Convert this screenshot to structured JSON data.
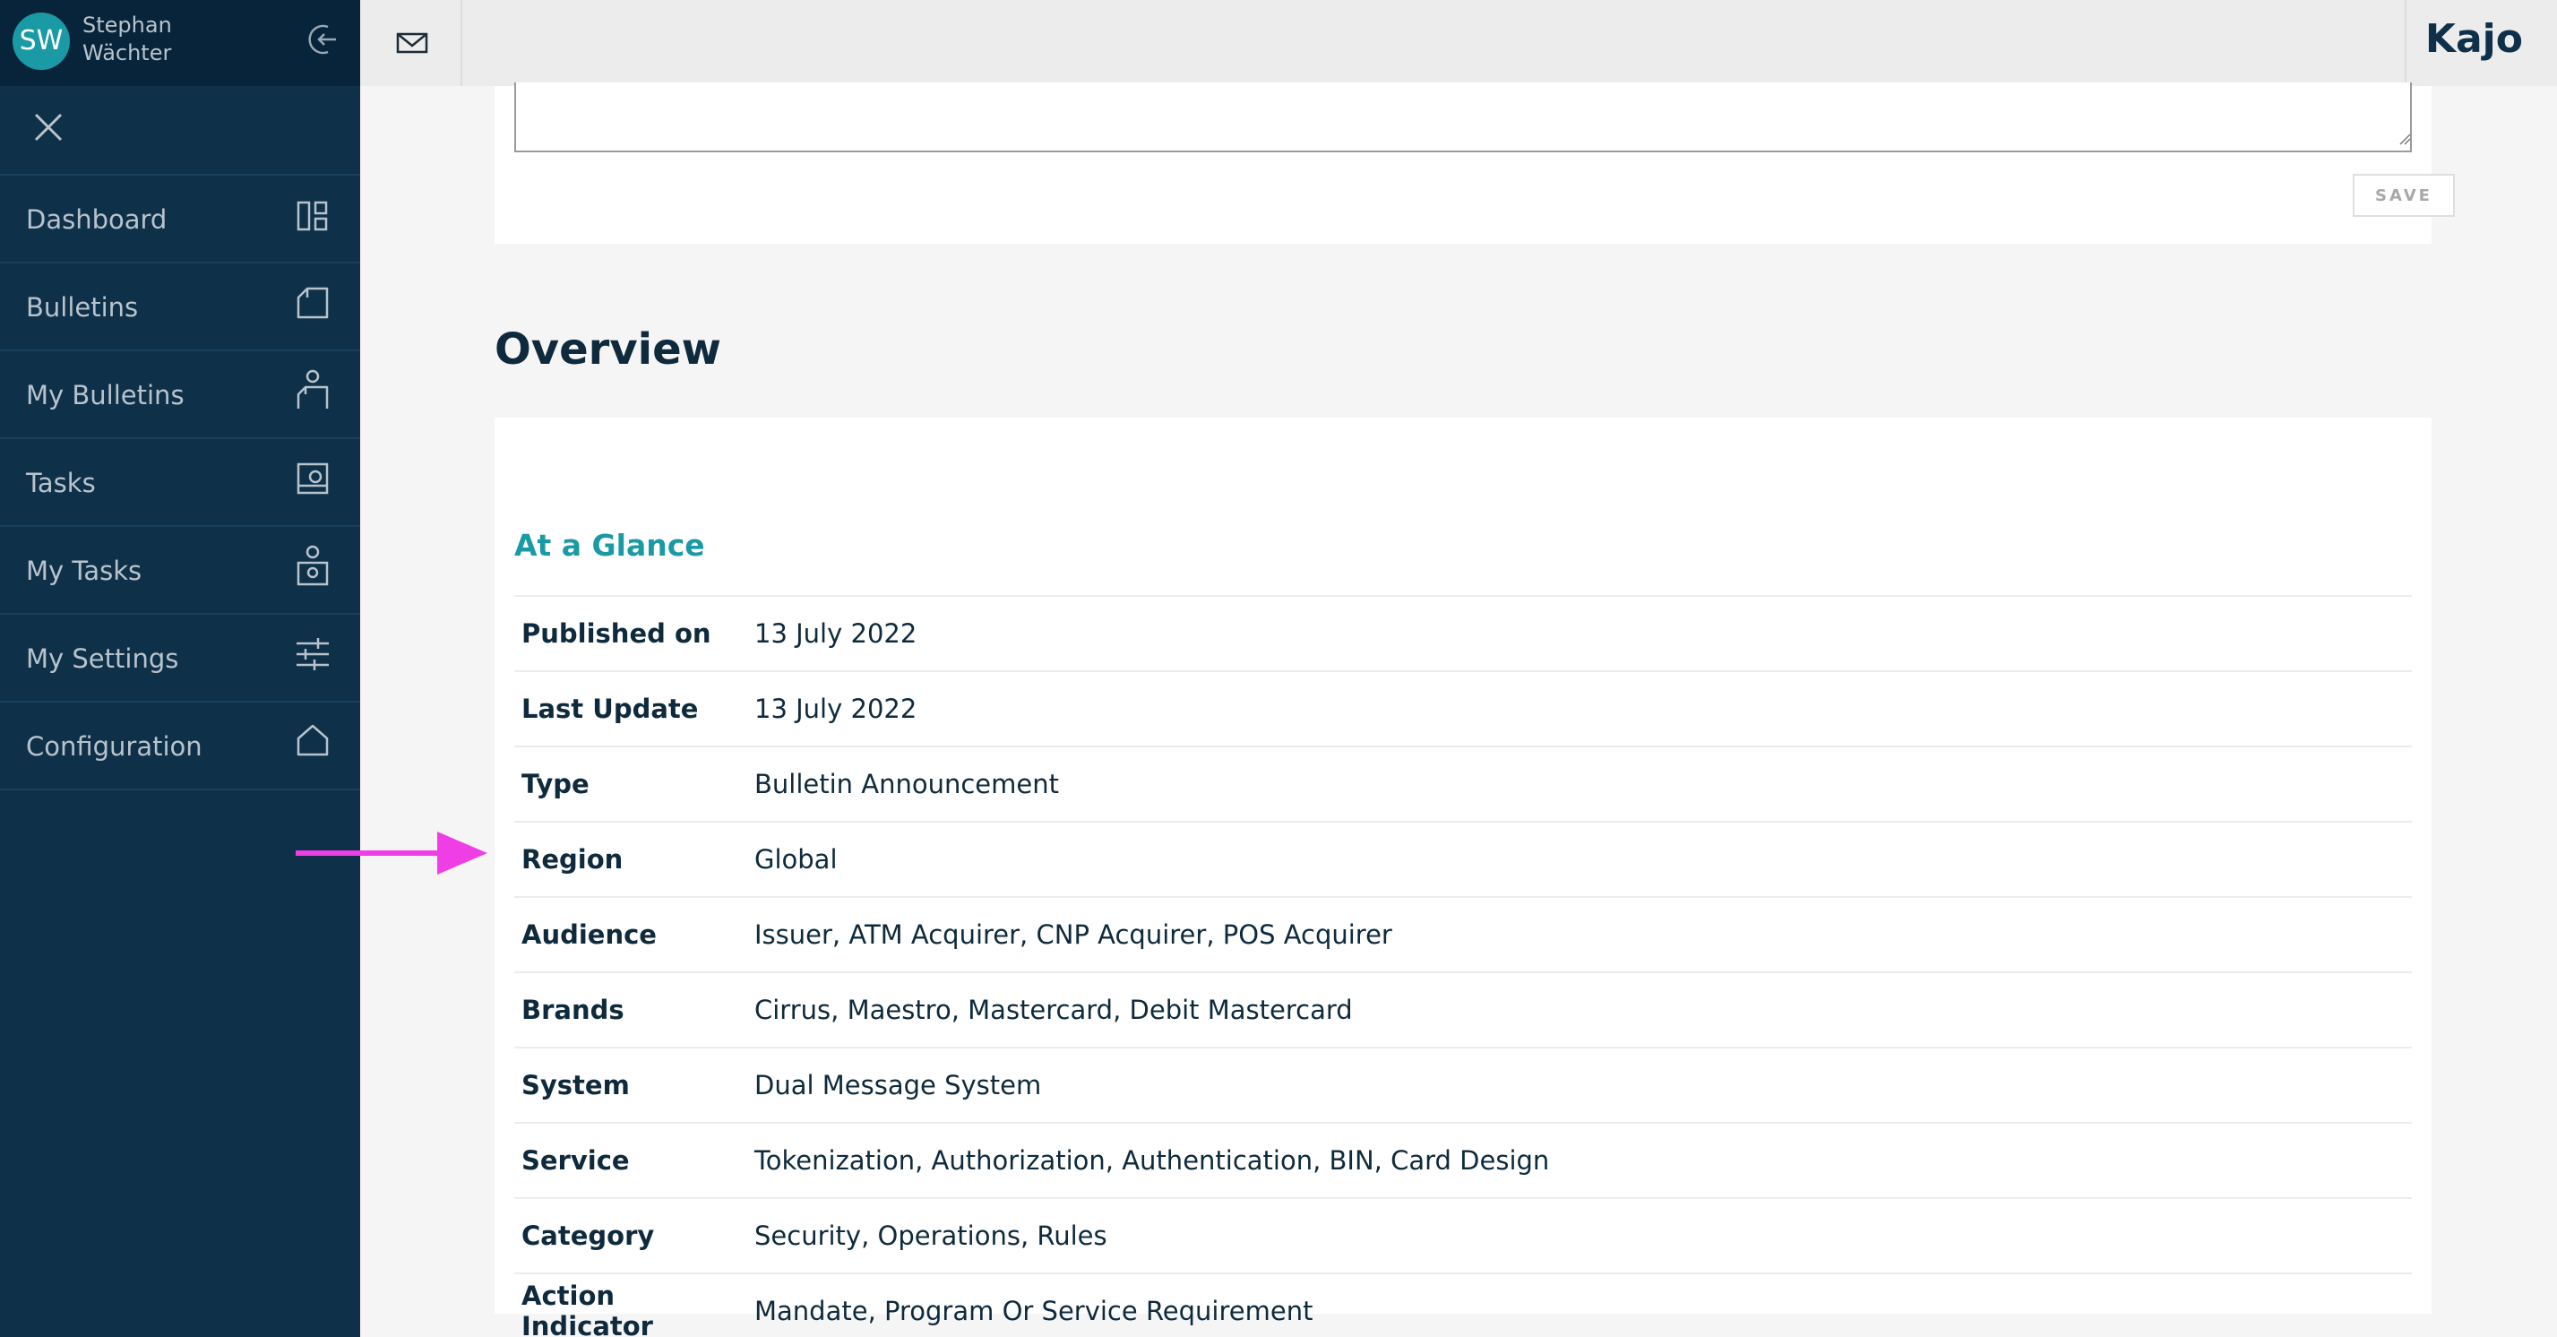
{
  "user": {
    "initials": "SW",
    "name": "Stephan Wächter"
  },
  "sidebar": {
    "items": [
      {
        "label": "Dashboard",
        "icon": "dashboard-icon"
      },
      {
        "label": "Bulletins",
        "icon": "bulletin-icon"
      },
      {
        "label": "My Bulletins",
        "icon": "person-bulletin-icon"
      },
      {
        "label": "Tasks",
        "icon": "task-icon"
      },
      {
        "label": "My Tasks",
        "icon": "person-task-icon"
      },
      {
        "label": "My Settings",
        "icon": "sliders-icon"
      },
      {
        "label": "Configuration",
        "icon": "home-icon"
      }
    ]
  },
  "header": {
    "brand": "Kajo"
  },
  "comment": {
    "save_label": "SAVE"
  },
  "overview": {
    "title": "Overview",
    "glance_title": "At a Glance",
    "rows": [
      {
        "key": "Published on",
        "value": "13 July 2022"
      },
      {
        "key": "Last Update",
        "value": "13 July 2022"
      },
      {
        "key": "Type",
        "value": "Bulletin Announcement"
      },
      {
        "key": "Region",
        "value": "Global"
      },
      {
        "key": "Audience",
        "value": "Issuer, ATM Acquirer, CNP Acquirer, POS Acquirer"
      },
      {
        "key": "Brands",
        "value": "Cirrus, Maestro, Mastercard, Debit Mastercard"
      },
      {
        "key": "System",
        "value": "Dual Message System"
      },
      {
        "key": "Service",
        "value": "Tokenization, Authorization, Authentication, BIN, Card Design"
      },
      {
        "key": "Category",
        "value": "Security, Operations, Rules"
      },
      {
        "key": "Action Indicator",
        "value": "Mandate, Program Or Service Requirement"
      }
    ]
  },
  "colors": {
    "sidebar_bg": "#0e3049",
    "accent": "#1a9aa5",
    "annotation_arrow": "#f03ee6"
  }
}
